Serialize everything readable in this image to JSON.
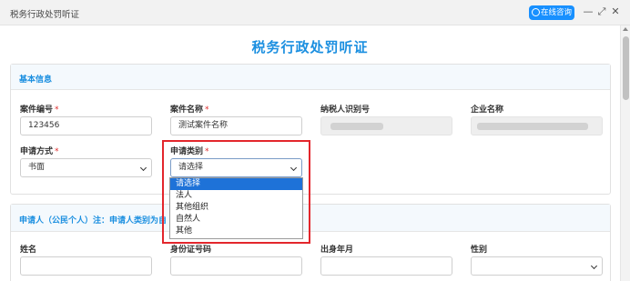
{
  "window": {
    "title": "税务行政处罚听证",
    "consult_label": "在线咨询",
    "minimize_glyph": "—",
    "restore_glyph": "⤢",
    "close_glyph": "✕"
  },
  "page_title": "税务行政处罚听证",
  "basic_info": {
    "heading": "基本信息",
    "case_no": {
      "label": "案件编号",
      "required_mark": "*",
      "value": "123456"
    },
    "case_name": {
      "label": "案件名称",
      "required_mark": "*",
      "value": "测试案件名称"
    },
    "taxpayer_id": {
      "label": "纳税人识别号"
    },
    "company_name": {
      "label": "企业名称"
    },
    "apply_method": {
      "label": "申请方式",
      "required_mark": "*",
      "value": "书面"
    },
    "apply_type": {
      "label": "申请类别",
      "required_mark": "*",
      "value": "请选择",
      "options": [
        "请选择",
        "法人",
        "其他组织",
        "自然人",
        "其他"
      ]
    }
  },
  "applicant": {
    "heading": "申请人（公民个人）注：申请人类别为自",
    "name_label": "姓名",
    "id_label": "身份证号码",
    "birth_label": "出身年月",
    "gender_label": "性别"
  },
  "colors": {
    "accent": "#1b8fe0",
    "highlight": "#e3262c",
    "selected_option": "#1e72d8"
  }
}
